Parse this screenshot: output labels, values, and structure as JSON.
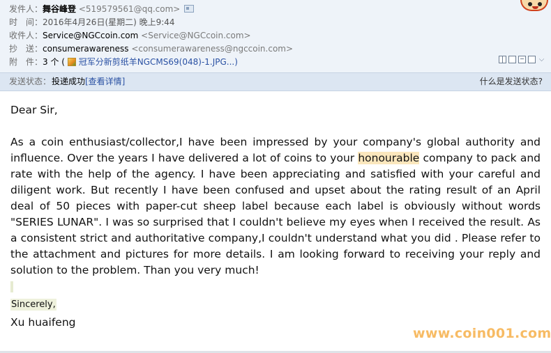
{
  "header": {
    "from": {
      "label": "发件人：",
      "name": "舞谷峰登",
      "address": "<519579561@qq.com>"
    },
    "time": {
      "label": "时　间：",
      "value": "2016年4月26日(星期二) 晚上9:44"
    },
    "to": {
      "label": "收件人：",
      "name": "Service@NGCcoin.com",
      "address": "<Service@NGCcoin.com>"
    },
    "cc": {
      "label": "抄　送：",
      "name": "consumerawareness",
      "address": "<consumerawareness@ngccoin.com>"
    },
    "attachments": {
      "label": "附　件：",
      "count": "3 个 (",
      "file": "冠军分新剪纸羊NGCMS69(048)-1.JPG...)"
    }
  },
  "status_bar": {
    "label": "发送状态：",
    "value": "投递成功",
    "details_link": "[查看详情]",
    "help_link": "什么是发送状态?"
  },
  "email": {
    "greeting": "Dear Sir,",
    "p1_before": "As a coin enthusiast/collector,I have been impressed by your company's global authority and influence. Over the years I have delivered a lot of coins to your ",
    "p1_highlight": "honourable",
    "p1_after": " company to pack and rate with the help of the agency. I have been appreciating and satisfied with your careful and diligent work. But recently I have been confused and upset about the rating result of an April deal of 50 pieces with paper-cut sheep label because each label is obviously without words \"SERIES LUNAR\". I was so surprised that I couldn't believe my eyes when I received the result. As a consistent strict and authoritative company,I couldn't understand what you did . Please refer to the attachment and pictures for more details. I am looking forward to receiving your reply and solution to the problem. Than you very much!",
    "closing": "Sincerely,",
    "signature": "Xu huaifeng"
  },
  "watermark": "www.coin001.com",
  "icons": [
    "contact-card-icon",
    "image-file-icon",
    "mascot-icon",
    "window-split-icon",
    "print-icon",
    "expand-icon"
  ],
  "colors": {
    "header_bg": "#eef3f9",
    "status_bg": "#dce6f2",
    "link": "#2a51a3",
    "highlight": "#fbe7bd",
    "watermark": "#f6b04a"
  }
}
